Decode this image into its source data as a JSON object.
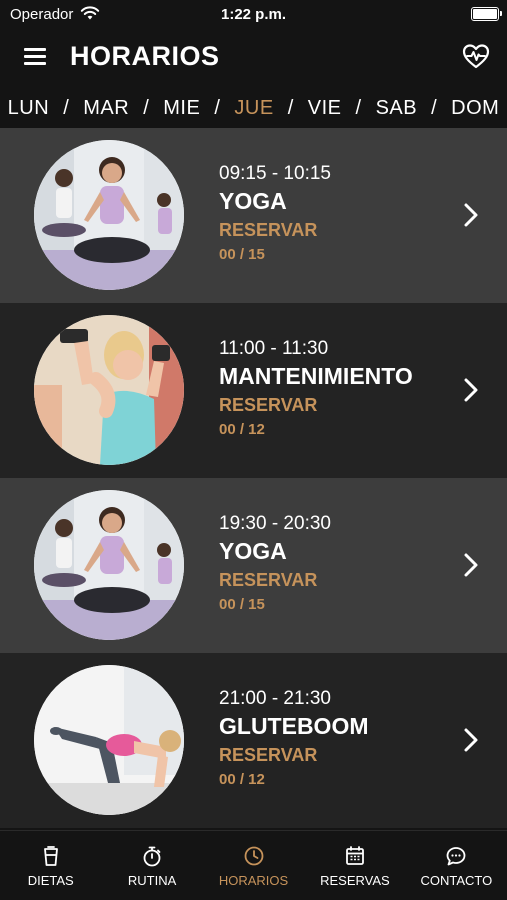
{
  "status_bar": {
    "carrier": "Operador",
    "time": "1:22 p.m."
  },
  "header": {
    "title": "HORARIOS",
    "menu_icon": "hamburger-menu-icon",
    "action_icon": "heart-pulse-icon"
  },
  "days": {
    "items": [
      "LUN",
      "MAR",
      "MIE",
      "JUE",
      "VIE",
      "SAB",
      "DOM"
    ],
    "separator": "/",
    "selected": "JUE"
  },
  "classes": [
    {
      "time": "09:15 - 10:15",
      "name": "YOGA",
      "action": "RESERVAR",
      "capacity": "00 / 15",
      "image": "yoga-class-photo"
    },
    {
      "time": "11:00 - 11:30",
      "name": "MANTENIMIENTO",
      "action": "RESERVAR",
      "capacity": "00 / 12",
      "image": "dumbbell-workout-photo"
    },
    {
      "time": "19:30 - 20:30",
      "name": "YOGA",
      "action": "RESERVAR",
      "capacity": "00 / 15",
      "image": "yoga-class-photo"
    },
    {
      "time": "21:00 - 21:30",
      "name": "GLUTEBOOM",
      "action": "RESERVAR",
      "capacity": "00 / 12",
      "image": "glute-exercise-photo"
    }
  ],
  "tabs": [
    {
      "label": "DIETAS",
      "icon": "cup-icon"
    },
    {
      "label": "RUTINA",
      "icon": "stopwatch-icon"
    },
    {
      "label": "HORARIOS",
      "icon": "clock-icon"
    },
    {
      "label": "RESERVAS",
      "icon": "calendar-icon"
    },
    {
      "label": "CONTACTO",
      "icon": "chat-bubble-icon"
    }
  ],
  "colors": {
    "accent": "#c6935b",
    "background": "#141414",
    "row_light": "#3d3d3d",
    "row_dark": "#232323"
  }
}
